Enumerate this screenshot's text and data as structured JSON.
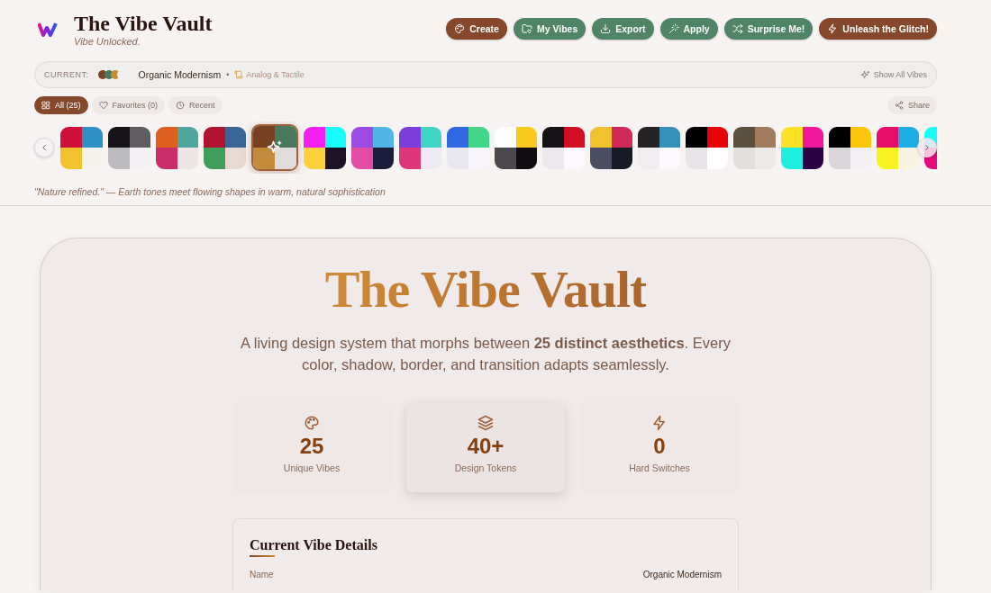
{
  "brand": {
    "title": "The Vibe Vault",
    "tagline": "Vibe Unlocked."
  },
  "actions": [
    {
      "label": "Create",
      "kind": "primary"
    },
    {
      "label": "My Vibes",
      "kind": "secondary"
    },
    {
      "label": "Export",
      "kind": "secondary"
    },
    {
      "label": "Apply",
      "kind": "secondary"
    },
    {
      "label": "Surprise Me!",
      "kind": "secondary"
    },
    {
      "label": "Unleash the Glitch!",
      "kind": "primary"
    }
  ],
  "current": {
    "label": "CURRENT:",
    "dots": [
      {
        "color": "#7a4424"
      },
      {
        "color": "#487b5c"
      },
      {
        "color": "#c98d32"
      },
      {
        "color": "#f2eeee"
      }
    ],
    "name": "Organic Modernism",
    "separator": "•",
    "category": "Analog & Tactile",
    "show_all": "Show All Vibes"
  },
  "filters": [
    {
      "label": "All (25)",
      "selected": true
    },
    {
      "label": "Favorites (0)",
      "selected": false
    },
    {
      "label": "Recent",
      "selected": false
    }
  ],
  "share": "Share",
  "vibes": [
    {
      "quadrants": [
        {
          "color": "#d0103a"
        },
        {
          "color": "#2e90c4"
        },
        {
          "color": "#f2c12e"
        },
        {
          "color": "#f6f3ee"
        }
      ],
      "selected": false
    },
    {
      "quadrants": [
        {
          "color": "#161416"
        },
        {
          "color": "#5f5d60"
        },
        {
          "color": "#bcbbbe"
        },
        {
          "color": "#f3f1f4"
        }
      ],
      "selected": false
    },
    {
      "quadrants": [
        {
          "color": "#dd6220"
        },
        {
          "color": "#4ea69f"
        },
        {
          "color": "#c92e6b"
        },
        {
          "color": "#ede6e4"
        }
      ],
      "selected": false
    },
    {
      "quadrants": [
        {
          "color": "#b2112f"
        },
        {
          "color": "#3a6697"
        },
        {
          "color": "#3f9e59"
        },
        {
          "color": "#e6dad2"
        }
      ],
      "selected": false
    },
    {
      "quadrants": [
        {
          "color": "#774124"
        },
        {
          "color": "#477a5c"
        },
        {
          "color": "#c48a3c"
        },
        {
          "color": "#e0dcdc"
        }
      ],
      "selected": true
    },
    {
      "quadrants": [
        {
          "color": "#f21ff0"
        },
        {
          "color": "#18fdfb"
        },
        {
          "color": "#fcd23a"
        },
        {
          "color": "#1d1226"
        }
      ],
      "selected": false
    },
    {
      "quadrants": [
        {
          "color": "#9c4be2"
        },
        {
          "color": "#52b5e8"
        },
        {
          "color": "#e34ca5"
        },
        {
          "color": "#1b1d3a"
        }
      ],
      "selected": false
    },
    {
      "quadrants": [
        {
          "color": "#7b3ed8"
        },
        {
          "color": "#42d5c6"
        },
        {
          "color": "#dc377b"
        },
        {
          "color": "#ecebf4"
        }
      ],
      "selected": false
    },
    {
      "quadrants": [
        {
          "color": "#2f68e0"
        },
        {
          "color": "#43d68a"
        },
        {
          "color": "#e9e8f0"
        },
        {
          "color": "#f7f5fa"
        }
      ],
      "selected": false
    },
    {
      "quadrants": [
        {
          "color": "#ffffff"
        },
        {
          "color": "#fac920"
        },
        {
          "color": "#4b494d"
        },
        {
          "color": "#0f0d10"
        }
      ],
      "selected": false
    },
    {
      "quadrants": [
        {
          "color": "#151315"
        },
        {
          "color": "#d10e24"
        },
        {
          "color": "#ebe9ee"
        },
        {
          "color": "#faf8fc"
        }
      ],
      "selected": false
    },
    {
      "quadrants": [
        {
          "color": "#efc22e"
        },
        {
          "color": "#d22a58"
        },
        {
          "color": "#4b4e62"
        },
        {
          "color": "#181a26"
        }
      ],
      "selected": false
    },
    {
      "quadrants": [
        {
          "color": "#252326"
        },
        {
          "color": "#388fb9"
        },
        {
          "color": "#efedf0"
        },
        {
          "color": "#faf8fb"
        }
      ],
      "selected": false
    },
    {
      "quadrants": [
        {
          "color": "#000000"
        },
        {
          "color": "#e80309"
        },
        {
          "color": "#e7e5e8"
        },
        {
          "color": "#ffffff"
        }
      ],
      "selected": false
    },
    {
      "quadrants": [
        {
          "color": "#5c513e"
        },
        {
          "color": "#a07b5c"
        },
        {
          "color": "#e3dfdd"
        },
        {
          "color": "#ece9e7"
        }
      ],
      "selected": false
    },
    {
      "quadrants": [
        {
          "color": "#fce225"
        },
        {
          "color": "#ef179a"
        },
        {
          "color": "#1fede0"
        },
        {
          "color": "#2b0244"
        }
      ],
      "selected": false
    },
    {
      "quadrants": [
        {
          "color": "#000000"
        },
        {
          "color": "#f9c50d"
        },
        {
          "color": "#d9d7da"
        },
        {
          "color": "#f3f1f4"
        }
      ],
      "selected": false
    },
    {
      "quadrants": [
        {
          "color": "#e50c6a"
        },
        {
          "color": "#1eaee6"
        },
        {
          "color": "#f6f321"
        },
        {
          "color": "#fbf3e1"
        }
      ],
      "selected": false
    },
    {
      "quadrants": [
        {
          "color": "#17fef9"
        },
        {
          "color": "#e5097d"
        }
      ],
      "selected": false
    }
  ],
  "quote": "\"Nature refined.\" — Earth tones meet flowing shapes in warm, natural sophistication",
  "hero": {
    "title": "The Vibe Vault",
    "subtitle": "A living design system that morphs between **25 distinct aesthetics**. Every color, shadow, border, and transition adapts seamlessly.",
    "stats": [
      {
        "value": "25",
        "label": "Unique Vibes",
        "highlighted": false
      },
      {
        "value": "40+",
        "label": "Design Tokens",
        "highlighted": true
      },
      {
        "value": "0",
        "label": "Hard Switches",
        "highlighted": false
      }
    ]
  },
  "details": {
    "title": "Current Vibe Details",
    "rows": [
      {
        "label": "Name",
        "value": "Organic Modernism"
      }
    ]
  }
}
